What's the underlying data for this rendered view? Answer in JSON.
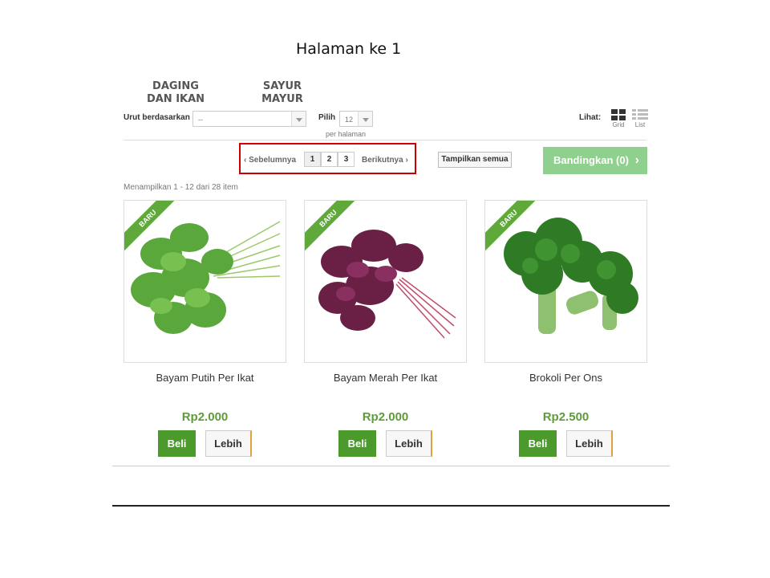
{
  "slide_title": "Halaman ke 1",
  "categories": [
    {
      "label": "DAGING DAN IKAN"
    },
    {
      "label": "SAYUR MAYUR"
    }
  ],
  "toolbar": {
    "sort_label": "Urut berdasarkan",
    "sort_value": "--",
    "pilih_label": "Pilih",
    "per_page_value": "12",
    "per_page_label": "per halaman",
    "view_label": "Lihat:",
    "view_grid": "Grid",
    "view_list": "List",
    "view_grid_icon": "grid-icon",
    "view_list_icon": "list-icon"
  },
  "pagination": {
    "prev": "Sebelumnya",
    "next": "Berikutnya",
    "pages": [
      "1",
      "2",
      "3"
    ],
    "current_page": "1"
  },
  "show_all": "Tampilkan semua",
  "compare": "Bandingkan (0)",
  "result_info": "Menampilkan 1 - 12 dari 28 item",
  "products": [
    {
      "badge": "BARU",
      "name": "Bayam Putih Per Ikat",
      "price": "Rp2.000",
      "image": "green-spinach-bunch"
    },
    {
      "badge": "BARU",
      "name": "Bayam Merah Per Ikat",
      "price": "Rp2.000",
      "image": "red-spinach-bunch"
    },
    {
      "badge": "BARU",
      "name": "Brokoli Per Ons",
      "price": "Rp2.500",
      "image": "broccoli"
    }
  ],
  "buttons": {
    "buy": "Beli",
    "more": "Lebih"
  },
  "colors": {
    "accent_green": "#4a9b2c",
    "price_green": "#5f9b3a",
    "compare_green": "#8fd08f",
    "highlight_red": "#cc0000"
  }
}
